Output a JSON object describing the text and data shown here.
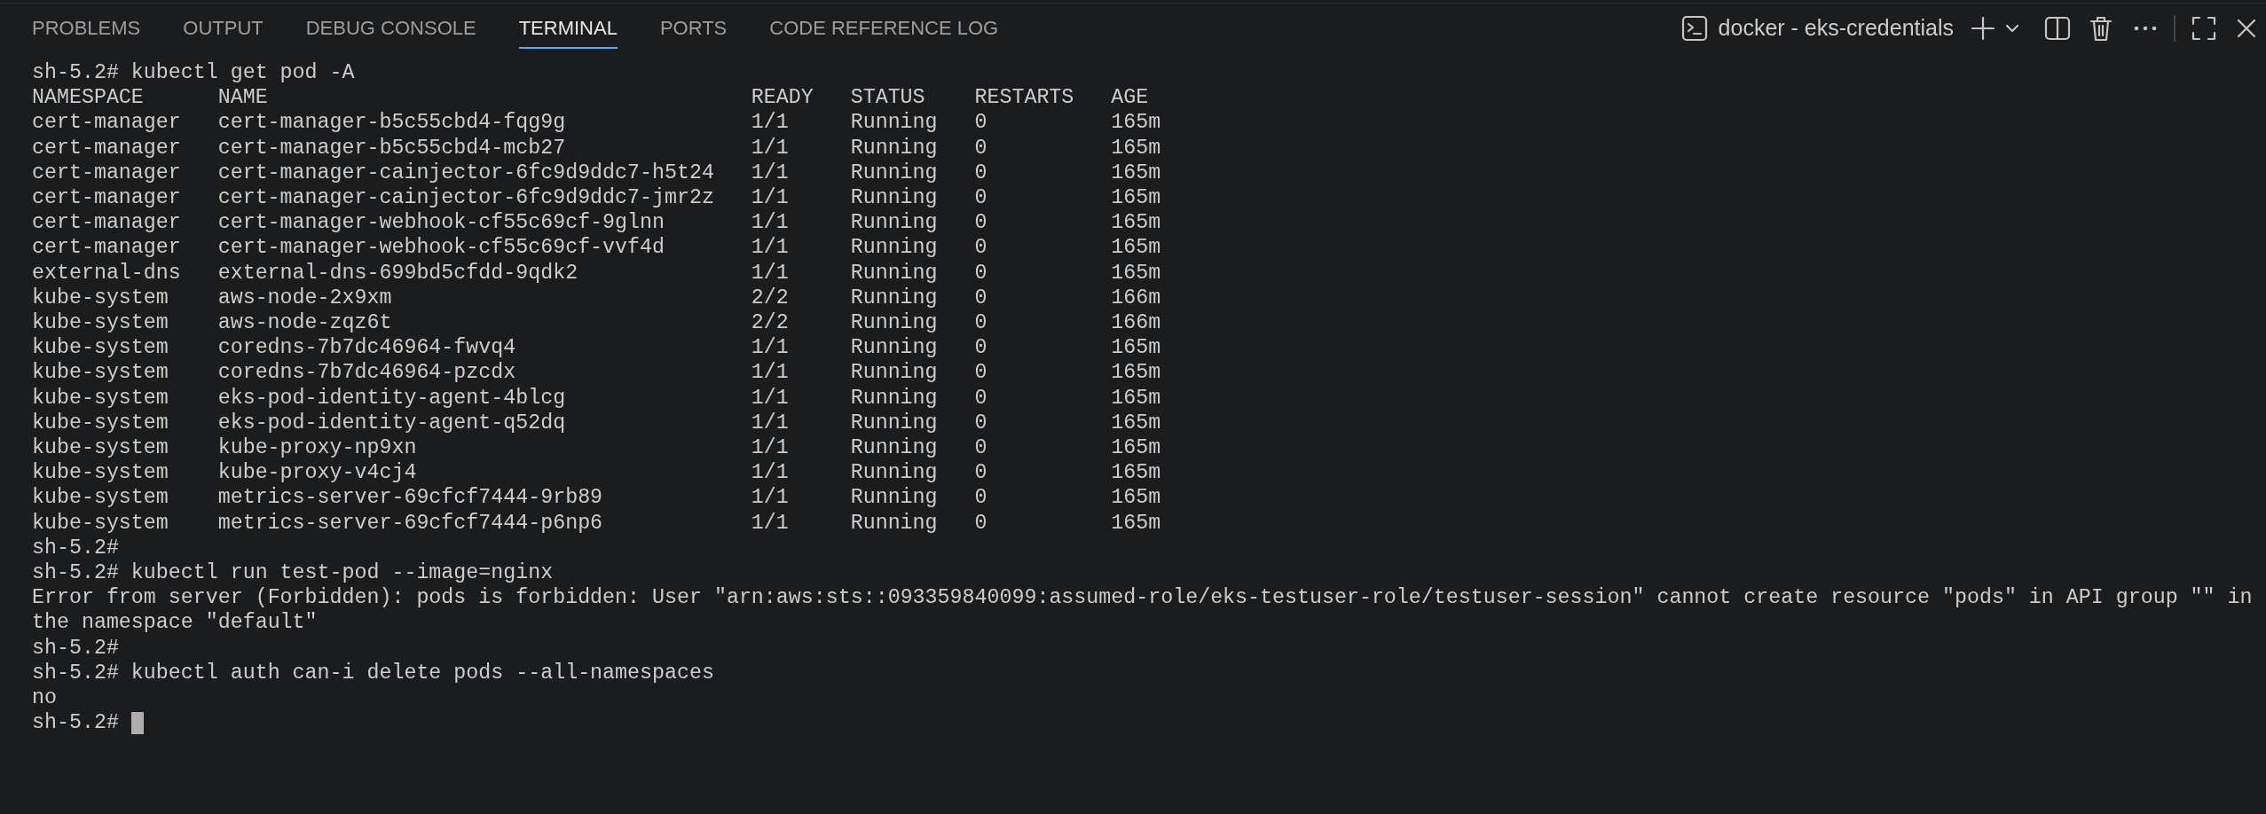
{
  "panel_tabs": [
    {
      "label": "PROBLEMS",
      "selected": false
    },
    {
      "label": "OUTPUT",
      "selected": false
    },
    {
      "label": "DEBUG CONSOLE",
      "selected": false
    },
    {
      "label": "TERMINAL",
      "selected": true
    },
    {
      "label": "PORTS",
      "selected": false
    },
    {
      "label": "CODE REFERENCE LOG",
      "selected": false
    }
  ],
  "terminal_title": "docker - eks-credentials",
  "terminal": [
    {
      "kind": "line",
      "text": "sh-5.2# kubectl get pod -A"
    },
    {
      "kind": "table",
      "columns": [
        "NAMESPACE",
        "NAME",
        "READY",
        "STATUS",
        "RESTARTS",
        "AGE"
      ],
      "rows": [
        [
          "cert-manager",
          "cert-manager-b5c55cbd4-fqg9g",
          "1/1",
          "Running",
          "0",
          "165m"
        ],
        [
          "cert-manager",
          "cert-manager-b5c55cbd4-mcb27",
          "1/1",
          "Running",
          "0",
          "165m"
        ],
        [
          "cert-manager",
          "cert-manager-cainjector-6fc9d9ddc7-h5t24",
          "1/1",
          "Running",
          "0",
          "165m"
        ],
        [
          "cert-manager",
          "cert-manager-cainjector-6fc9d9ddc7-jmr2z",
          "1/1",
          "Running",
          "0",
          "165m"
        ],
        [
          "cert-manager",
          "cert-manager-webhook-cf55c69cf-9glnn",
          "1/1",
          "Running",
          "0",
          "165m"
        ],
        [
          "cert-manager",
          "cert-manager-webhook-cf55c69cf-vvf4d",
          "1/1",
          "Running",
          "0",
          "165m"
        ],
        [
          "external-dns",
          "external-dns-699bd5cfdd-9qdk2",
          "1/1",
          "Running",
          "0",
          "165m"
        ],
        [
          "kube-system",
          "aws-node-2x9xm",
          "2/2",
          "Running",
          "0",
          "166m"
        ],
        [
          "kube-system",
          "aws-node-zqz6t",
          "2/2",
          "Running",
          "0",
          "166m"
        ],
        [
          "kube-system",
          "coredns-7b7dc46964-fwvq4",
          "1/1",
          "Running",
          "0",
          "165m"
        ],
        [
          "kube-system",
          "coredns-7b7dc46964-pzcdx",
          "1/1",
          "Running",
          "0",
          "165m"
        ],
        [
          "kube-system",
          "eks-pod-identity-agent-4blcg",
          "1/1",
          "Running",
          "0",
          "165m"
        ],
        [
          "kube-system",
          "eks-pod-identity-agent-q52dq",
          "1/1",
          "Running",
          "0",
          "165m"
        ],
        [
          "kube-system",
          "kube-proxy-np9xn",
          "1/1",
          "Running",
          "0",
          "165m"
        ],
        [
          "kube-system",
          "kube-proxy-v4cj4",
          "1/1",
          "Running",
          "0",
          "165m"
        ],
        [
          "kube-system",
          "metrics-server-69cfcf7444-9rb89",
          "1/1",
          "Running",
          "0",
          "165m"
        ],
        [
          "kube-system",
          "metrics-server-69cfcf7444-p6np6",
          "1/1",
          "Running",
          "0",
          "165m"
        ]
      ]
    },
    {
      "kind": "line",
      "text": "sh-5.2#"
    },
    {
      "kind": "line",
      "text": "sh-5.2# kubectl run test-pod --image=nginx"
    },
    {
      "kind": "line",
      "text": "Error from server (Forbidden): pods is forbidden: User \"arn:aws:sts::093359840099:assumed-role/eks-testuser-role/testuser-session\" cannot create resource \"pods\" in API group \"\" in"
    },
    {
      "kind": "line",
      "text": "the namespace \"default\""
    },
    {
      "kind": "line",
      "text": "sh-5.2#"
    },
    {
      "kind": "line",
      "text": "sh-5.2# kubectl auth can-i delete pods --all-namespaces"
    },
    {
      "kind": "line",
      "text": "no"
    },
    {
      "kind": "prompt",
      "text": "sh-5.2#"
    }
  ]
}
